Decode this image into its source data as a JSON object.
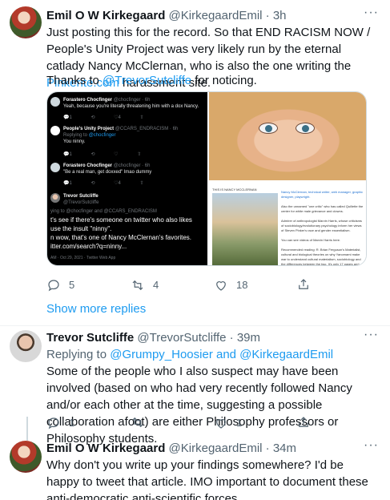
{
  "tweet1": {
    "name": "Emil O W Kirkegaard",
    "handle": "@KirkegaardEmil",
    "time": "3h",
    "more": "···",
    "text_before_link": "Just posting this for the record. So that END RACISM NOW / People's Unity Project was very likely run by the eternal catlady Nancy McClernan, who is also the one writing the ",
    "link": "Pinkerite.com",
    "text_after_link": " harassment site.",
    "thanks_before": "Thanks to ",
    "thanks_link": "@TrevorSutcliffe",
    "thanks_after": " for noticing.",
    "media_left": {
      "t1_name": "Forastero Chocfinger",
      "t1_meta": "@chocfinger · 6h",
      "t1_text": "Yeah, because you're literally threatening him with a dox Nancy.",
      "t2_name": "People's Unity Project",
      "t2_meta": "@CCARS_ENDRACISM · 6h",
      "t2_reply_prefix": "Replying to ",
      "t2_reply_handle": "@chocfinger",
      "t2_text": "You ninny.",
      "t3_name": "Forastero Chocfinger",
      "t3_meta": "@chocfinger · 6h",
      "t3_text": "\"Be a real man, get doxxed\" lmao dummy",
      "t4_name": "Trevor Sutcliffe",
      "t4_handle": "@TrevorSutcliffe",
      "t4_reply": "ying to @chocfinger and @CCARS_ENDRACISM",
      "t4_line1": "t's see if there's someone on twitter who also likes",
      "t4_line2": "use the insult \"ninny\".",
      "t4_line3": "n wow, that's one of Nancy McClernan's favorites.",
      "t4_line4": "itter.com/search?q=ninny...",
      "t4_time": "AM · Oct 29, 2021 · Twitter Web App"
    },
    "media_right": {
      "caption": "THIS IS NANCY MCCLERNAN",
      "ref1": "Nancy McClernan, technical writer, web manager, graphic designer, playwright.",
      "ref2": "Also the unnamed \"one critic\" who has called Quillette the center for white male grievance and clowns.",
      "ref3": "Admirer of anthropologist Marvin Harris, whose criticisms of sociobiology/evolutionary psychology inform her views of Steven Pinker's race and gender essentialism.",
      "ref4": "You can see videos of Marvin Harris here.",
      "ref5": "Recommended reading: R. Brian Ferguson's Materialist, cultural and biological theories on why Yanomami make war to understand cultural materialism, sociobiology and the differences between the two. It's only 17 pages and"
    },
    "replies": "5",
    "retweets": "4",
    "likes": "18"
  },
  "show_more": "Show more replies",
  "tweet2": {
    "name": "Trevor Sutcliffe",
    "handle": "@TrevorSutcliffe",
    "time": "39m",
    "more": "···",
    "reply_prefix": "Replying to ",
    "reply_handles": "@Grumpy_Hoosier and @KirkegaardEmil",
    "text": "Some of the people who I also suspect may have been involved (based on who had very recently followed Nancy and/or each other at the time, suggesting a possible collaboration afoot) are either Philosophy professors or Philosophy students.",
    "replies": "1",
    "likes": "1"
  },
  "tweet3": {
    "name": "Emil O W Kirkegaard",
    "handle": "@KirkegaardEmil",
    "time": "34m",
    "more": "···",
    "text": "Why don't you write up your findings somewhere? I'd be happy to tweet that article. IMO important to document these anti-democratic anti-scientific forces."
  },
  "colors": {
    "accent": "#1d9bf0",
    "text": "#0f1419",
    "muted": "#536471",
    "border": "#cfd9de"
  }
}
